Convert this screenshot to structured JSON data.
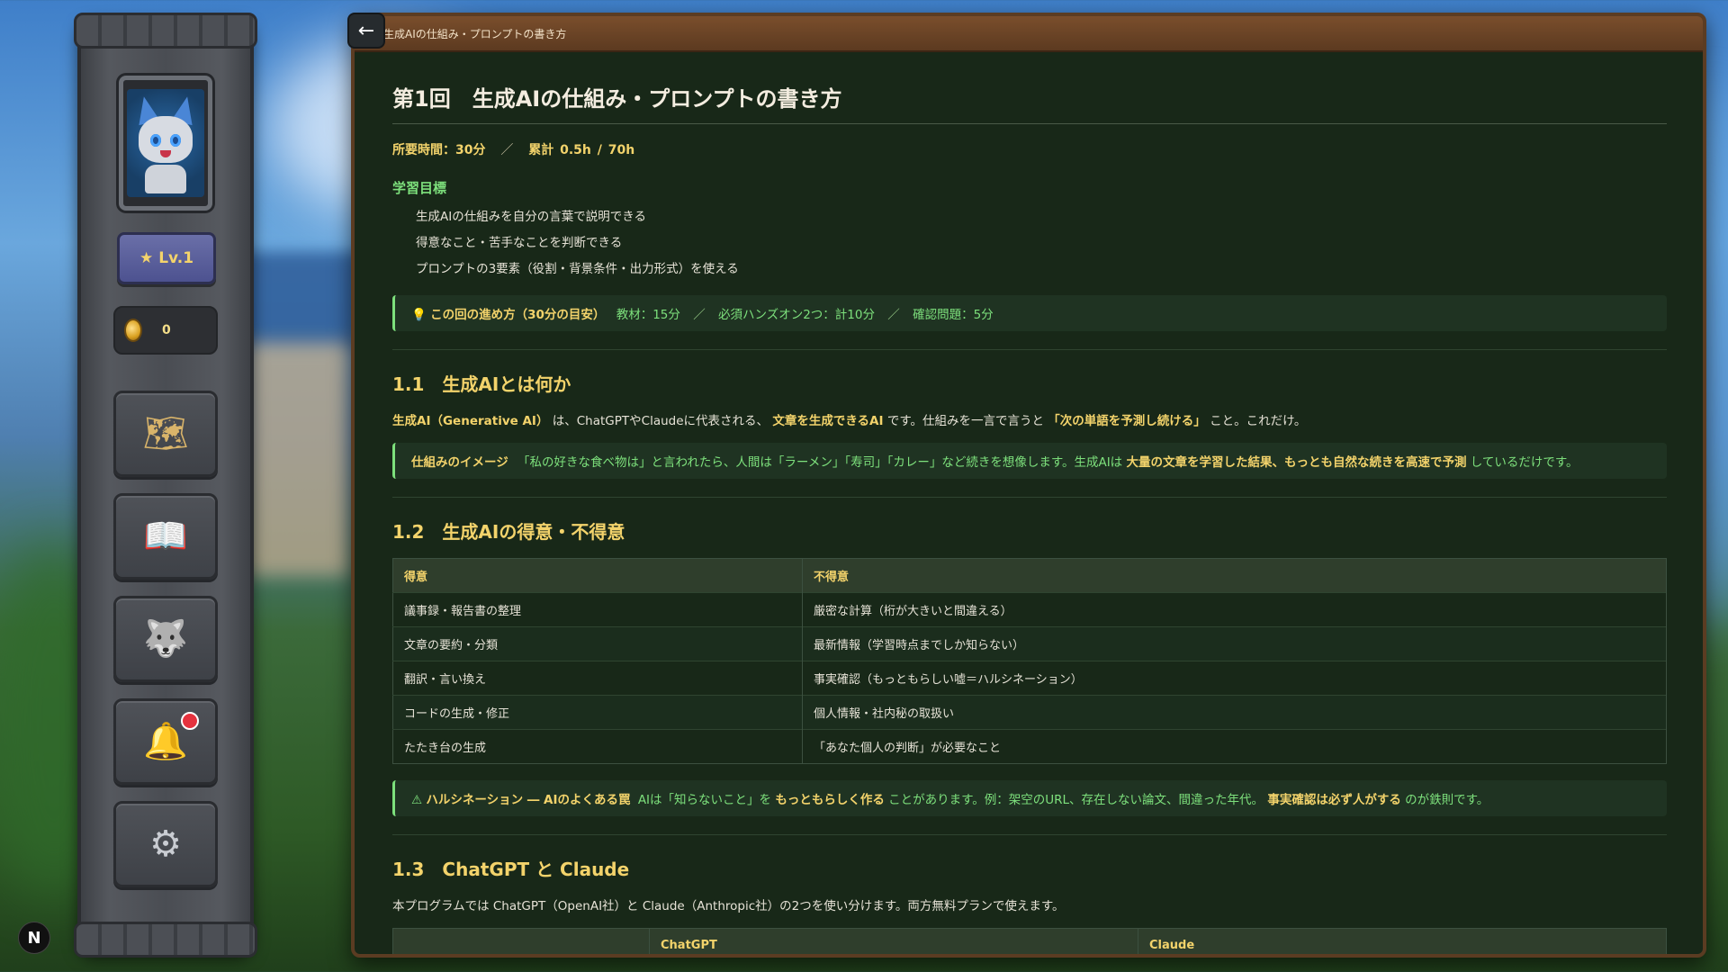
{
  "sidebar": {
    "level_label": "Lv.1",
    "coin_count": "0",
    "items": [
      {
        "name": "map",
        "icon": "map-icon"
      },
      {
        "name": "book",
        "icon": "book-icon"
      },
      {
        "name": "character",
        "icon": "character-icon"
      },
      {
        "name": "notifications",
        "icon": "bell-icon",
        "has_badge": true
      },
      {
        "name": "settings",
        "icon": "gear-icon"
      }
    ]
  },
  "n_badge": "N",
  "panel": {
    "header_title": "生成AIの仕組み・プロンプトの書き方",
    "back_icon": "←",
    "title": "第1回　生成AIの仕組み・プロンプトの書き方",
    "meta": {
      "required": "所要時間：30分",
      "sep": "／",
      "total": "累計 0.5h / 70h"
    },
    "goals_heading": "学習目標",
    "goals": [
      "生成AIの仕組みを自分の言葉で説明できる",
      "得意なこと・苦手なことを判断できる",
      "プロンプトの3要素（役割・背景条件・出力形式）を使える"
    ],
    "plan_callout": {
      "icon": "💡",
      "title": "この回の進め方（30分の目安）",
      "parts": [
        "教材：15分",
        "必須ハンズオン2つ：計10分",
        "確認問題：5分"
      ],
      "sep": "／"
    },
    "s1": {
      "heading": "1.1　生成AIとは何か",
      "p_a": "生成AI（Generative AI）",
      "p_b": "は、ChatGPTやClaudeに代表される、",
      "p_c": "文章を生成できるAI",
      "p_d": "です。仕組みを一言で言うと",
      "p_e": "「次の単語を予測し続ける」",
      "p_f": "こと。これだけ。",
      "callout_title": "仕組みのイメージ",
      "callout_a": "「私の好きな食べ物は」と言われたら、人間は「ラーメン」「寿司」「カレー」など続きを想像します。生成AIは",
      "callout_b": "大量の文章を学習した結果、もっとも自然な続きを高速で予測",
      "callout_c": "しているだけです。"
    },
    "s2": {
      "heading": "1.2　生成AIの得意・不得意",
      "headers": [
        "得意",
        "不得意"
      ],
      "rows": [
        [
          "議事録・報告書の整理",
          "厳密な計算（桁が大きいと間違える）"
        ],
        [
          "文章の要約・分類",
          "最新情報（学習時点までしか知らない）"
        ],
        [
          "翻訳・言い換え",
          "事実確認（もっともらしい嘘＝ハルシネーション）"
        ],
        [
          "コードの生成・修正",
          "個人情報・社内秘の取扱い"
        ],
        [
          "たたき台の生成",
          "「あなた個人の判断」が必要なこと"
        ]
      ],
      "warn_icon": "⚠",
      "warn_title": "ハルシネーション ― AIのよくある罠",
      "warn_a": "AIは「知らないこと」を",
      "warn_b": "もっともらしく作る",
      "warn_c": "ことがあります。例：架空のURL、存在しない論文、間違った年代。",
      "warn_d": "事実確認は必ず人がする",
      "warn_e": "のが鉄則です。"
    },
    "s3": {
      "heading": "1.3　ChatGPT と Claude",
      "para": "本プログラムでは ChatGPT（OpenAI社）と Claude（Anthropic社）の2つを使い分けます。両方無料プランで使えます。",
      "headers": [
        "",
        "ChatGPT",
        "Claude"
      ]
    }
  },
  "colors": {
    "accent_green": "#7de07c",
    "accent_gold": "#f3d36b",
    "panel_bg": "#182818",
    "frame_brown": "#5b3c22"
  }
}
